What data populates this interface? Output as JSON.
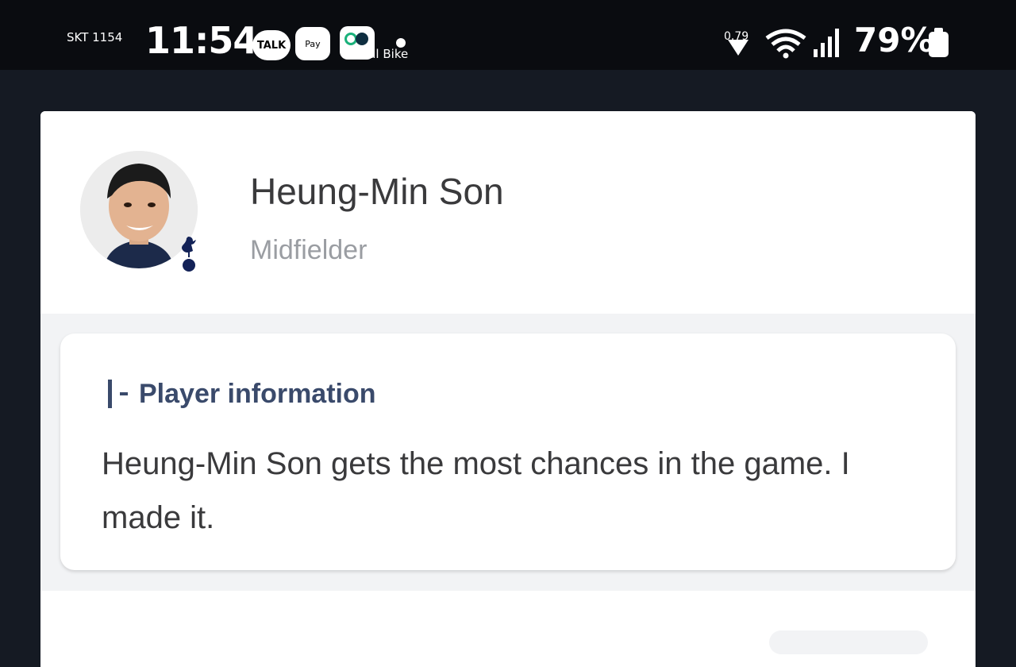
{
  "status_bar": {
    "carrier": "SKT 1154",
    "time": "11:54",
    "talk_label": "TALK",
    "pay_label": "Pay",
    "bike_label": "Seoul Bike",
    "net_speed": "0.79",
    "battery": "79%"
  },
  "profile": {
    "name": "Heung-Min Son",
    "position": "Midfielder",
    "badge_icon": "tottenham-cockerel-icon"
  },
  "player_info": {
    "title": "Player information",
    "text": "Heung-Min Son gets the most chances in the game. I made it."
  },
  "colors": {
    "accent": "#3a4a6b",
    "card_bg": "#ffffff",
    "page_bg": "#f2f3f5"
  }
}
